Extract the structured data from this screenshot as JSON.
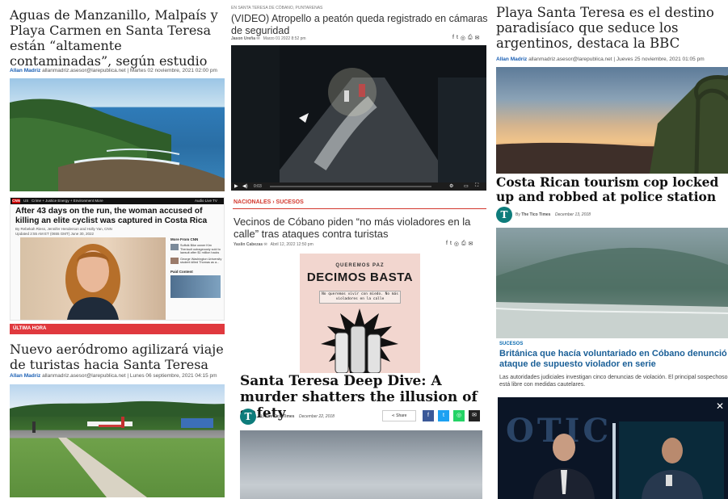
{
  "col1": {
    "article1": {
      "title": "Aguas de Manzanillo, Malpaís y Playa Carmen en Santa Teresa están “altamente contaminadas”, según estudio",
      "author": "Allan Madriz",
      "email": "allanmadriz.asesor@larepublica.net",
      "date": "| Martes 02 noviembre, 2021 02:00 pm"
    },
    "cnn": {
      "logo": "CNN",
      "region": "US",
      "nav": "Crime + Justice   Energy + Environment   More",
      "nav_right": "Audio   Live TV",
      "headline": "After 43 days on the run, the woman accused of killing an elite cyclist was captured in Costa Rica",
      "byline": "By Rebekah Riess, Jennifer Henderson and Holly Yan, CNN",
      "updated": "Updated 2:55 AM ET (0655 GMT) June 30, 2022",
      "side_heading": "More From CNN",
      "side_items": [
        "Suffolk Bike owner Kim Theriault outrageously sold to lawsuit after $1 million hacks",
        "George Washington University student killed Thomas as a..."
      ],
      "paid_heading": "Paid Content"
    },
    "ultima_hora": "ÚLTIMA HORA",
    "article2": {
      "title": "Nuevo aeródromo agilizará viaje de turistas hacia Santa Teresa",
      "author": "Allan Madriz",
      "email": "allanmadriz.asesor@larepublica.net",
      "date": "| Lunes 06 septiembre, 2021 04:15 pm"
    }
  },
  "col2": {
    "article1": {
      "kicker": "EN SANTA TERESA DE CÓBANO, PUNTARENAS",
      "title": "(VIDEO) Atropello a peatón queda registrado en cámaras de seguridad",
      "author": "Jason Ureña",
      "date": "Marzo 01 2022   8:52 pm",
      "video_time": "0:03"
    },
    "article2": {
      "section": "NACIONALES",
      "subsection": "SUCESOS",
      "title": "Vecinos de Cóbano piden “no más violadores en la calle” tras ataques contra turistas",
      "author": "Yaslin Cabezas",
      "date": "Abril 12, 2022   12:50 pm",
      "poster_top": "QUEREMOS PAZ",
      "poster_big": "DECIMOS BASTA",
      "poster_sub": "No queremos vivir con miedo. No más violadores en la calle"
    },
    "article3": {
      "title": "Santa Teresa Deep Dive: A murder shatters the illusion of safety",
      "by": "By",
      "author": "The Tico Times",
      "date": "December 22, 2018",
      "share": "Share"
    }
  },
  "col3": {
    "article1": {
      "title": "Playa Santa Teresa es el destino paradisíaco que seduce los argentinos, destaca la BBC",
      "author": "Allan Madriz",
      "email": "allanmadriz.asesor@larepublica.net",
      "date": "| Jueves 25 noviembre, 2021 01:05 pm"
    },
    "article2": {
      "title": "Costa Rican tourism cop locked up and robbed at police station",
      "by": "By",
      "author": "The Tico Times",
      "date": "December 13, 2018"
    },
    "article3": {
      "section": "SUCESOS",
      "title": "Británica que hacía voluntariado en Cóbano denunció ataque de supuesto violador en serie",
      "body": "Las autoridades judiciales investigan cinco denuncias de violación. El principal sospechoso está libre con medidas cautelares."
    },
    "video": {
      "bg_text": "OTIC"
    }
  },
  "colors": {
    "accent_red": "#e0393e",
    "link_blue": "#1a5fb4",
    "tico_teal": "#0e7c7b",
    "facebook": "#3b5998",
    "twitter": "#1da1f2",
    "whatsapp": "#25d366"
  }
}
